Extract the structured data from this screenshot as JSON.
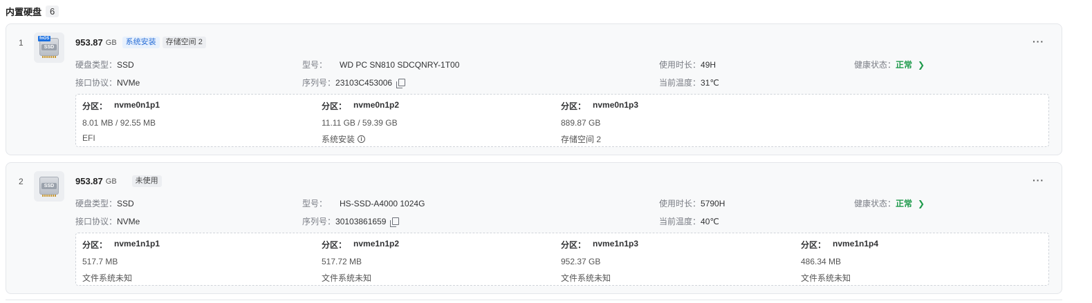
{
  "header": {
    "title": "内置硬盘",
    "count": "6"
  },
  "labels": {
    "disk_type": "硬盘类型：",
    "model": "型号：",
    "usage_time": "使用时长：",
    "health": "健康状态：",
    "interface": "接口协议：",
    "serial": "序列号：",
    "temperature": "当前温度：",
    "partition": "分区：",
    "more": "···"
  },
  "disks": [
    {
      "index": "1",
      "capacity": "953.87",
      "unit": "GB",
      "icon": "ssd-fnos-icon",
      "tags": [
        "系统安装",
        "存储空间 2"
      ],
      "disk_type": "SSD",
      "model": "WD PC SN810 SDCQNRY-1T00",
      "usage_time": "49H",
      "health": "正常",
      "interface": "NVMe",
      "serial": "23103C453006",
      "temperature": "31℃",
      "partitions": [
        {
          "name": "nvme0n1p1",
          "size": "8.01 MB / 92.55 MB",
          "fs": "EFI"
        },
        {
          "name": "nvme0n1p2",
          "size": "11.11 GB / 59.39 GB",
          "fs": "系统安装"
        },
        {
          "name": "nvme0n1p3",
          "size": "889.87 GB",
          "fs": "存储空间 2"
        }
      ]
    },
    {
      "index": "2",
      "capacity": "953.87",
      "unit": "GB",
      "icon": "ssd-icon",
      "tags": [
        "未使用"
      ],
      "disk_type": "SSD",
      "model": "HS-SSD-A4000 1024G",
      "usage_time": "5790H",
      "health": "正常",
      "interface": "NVMe",
      "serial": "30103861659",
      "temperature": "40℃",
      "partitions": [
        {
          "name": "nvme1n1p1",
          "size": "517.7 MB",
          "fs": "文件系统未知"
        },
        {
          "name": "nvme1n1p2",
          "size": "517.72 MB",
          "fs": "文件系统未知"
        },
        {
          "name": "nvme1n1p3",
          "size": "952.37 GB",
          "fs": "文件系统未知"
        },
        {
          "name": "nvme1n1p4",
          "size": "486.34 MB",
          "fs": "文件系统未知"
        }
      ]
    }
  ],
  "colors": {
    "healthy": "#1e9a4b",
    "tag_blue": "#2a6fd6",
    "fnos_badge": "#1a6fe0"
  }
}
